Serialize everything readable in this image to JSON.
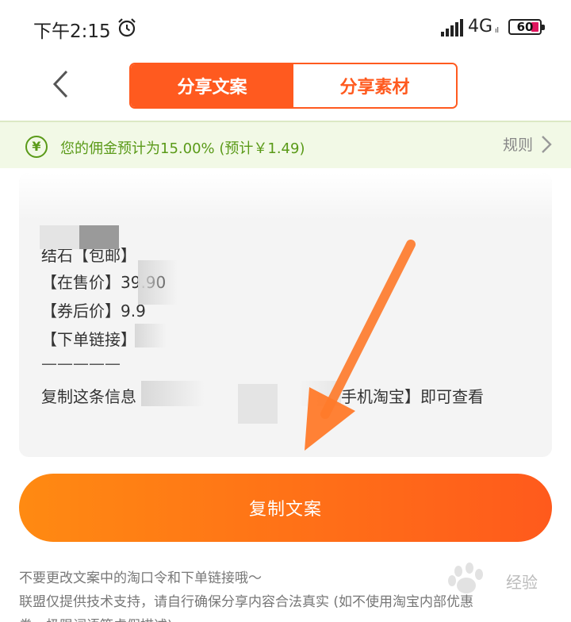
{
  "status_bar": {
    "time": "下午2:15",
    "network": "4G",
    "network_sub": "ıl",
    "battery": "60"
  },
  "nav": {
    "tabs": [
      {
        "label": "分享文案",
        "active": true
      },
      {
        "label": "分享素材",
        "active": false
      }
    ]
  },
  "commission": {
    "text": "您的佣金预计为15.00% (预计￥1.49)",
    "rule_label": "规则"
  },
  "copy_text": {
    "lines": [
      "结石【包邮】",
      "【在售价】39.90",
      "【券后价】9.9",
      "【下单链接】",
      "—————",
      "复制这条信息",
      "手机淘宝】即可查看"
    ]
  },
  "actions": {
    "copy_label": "复制文案"
  },
  "notes": [
    "不要更改文案中的淘口令和下单链接哦～",
    "联盟仅提供技术支持，请自行确保分享内容合法真实 (如不使用淘宝内部优惠",
    "券、极限词语等虚假描述)"
  ],
  "watermark": "经验",
  "colors": {
    "accent": "#ff5a1f",
    "commission_green": "#5a9a18",
    "button_gradient_start": "#ff8a12",
    "button_gradient_end": "#ff5a1c"
  },
  "icons": {
    "back": "chevron-left-icon",
    "alarm": "alarm-clock-icon",
    "signal": "signal-icon",
    "yen": "yen-circle-icon",
    "rule": "chevron-right-icon"
  }
}
